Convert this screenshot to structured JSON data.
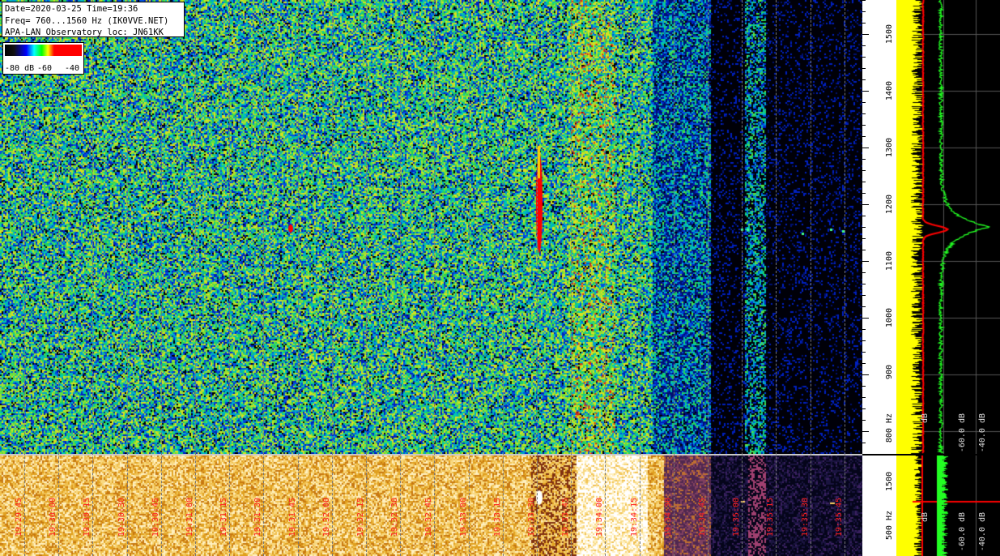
{
  "info": {
    "line1": "Date=2020-03-25 Time=19:36",
    "line2": "Freq= 760...1560 Hz (IK0VVE.NET)",
    "line3": "APA-LAN Observatory loc: JN61KK"
  },
  "legend": {
    "labels": [
      "-80 dB",
      "-60",
      "-40"
    ]
  },
  "freq_axis": {
    "labels": [
      "1500",
      "1400",
      "1300",
      "1200",
      "1100",
      "1000",
      "900",
      "800 Hz"
    ],
    "values": [
      1500,
      1400,
      1300,
      1200,
      1100,
      1000,
      900,
      800
    ],
    "range": [
      760,
      1560
    ]
  },
  "bottom_axis": {
    "labels": [
      "1500",
      "500 Hz"
    ]
  },
  "spectrum_labels": [
    "dB",
    "-60.0 dB",
    "-40.0 dB"
  ],
  "spectrum_labels_bottom": [
    "dB",
    "-60.0 dB",
    "-40.0 dB"
  ],
  "time_labels": [
    "19:29:45",
    "19:30:00",
    "19:30:15",
    "19:30:30",
    "19:30:45",
    "19:31:00",
    "19:31:15",
    "19:31:30",
    "19:31:45",
    "19:32:00",
    "19:32:15",
    "19:32:30",
    "19:32:45",
    "19:33:00",
    "19:33:15",
    "19:33:30",
    "19:33:45",
    "19:34:00",
    "19:34:15",
    "19:34:30",
    "19:34:45",
    "19:35:00",
    "19:35:15",
    "19:35:30",
    "19:35:45"
  ],
  "colors": {
    "waterfall_accent": "#00ff00",
    "time_label": "#ff2020",
    "spectrum_yellow": "#ffff00",
    "spectrum_green": "#22ff22",
    "spectrum_red": "#ff0000"
  }
}
